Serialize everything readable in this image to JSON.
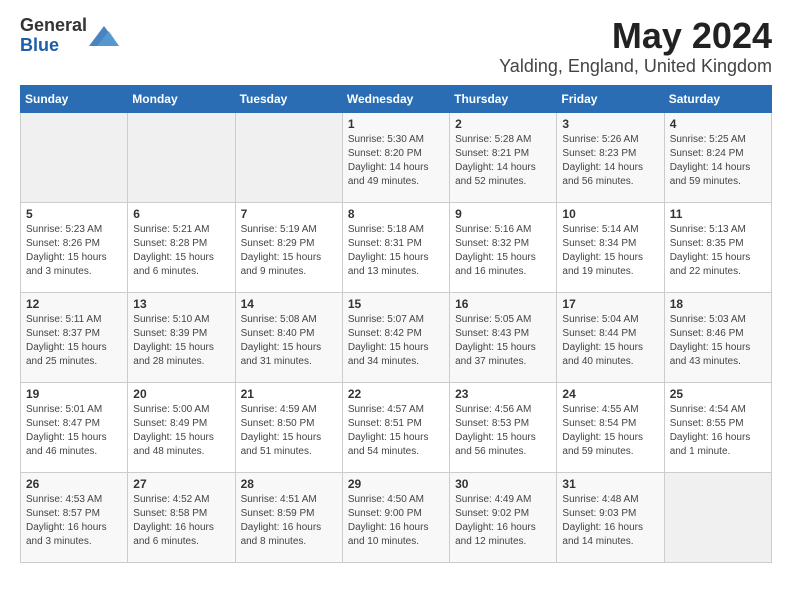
{
  "header": {
    "logo_general": "General",
    "logo_blue": "Blue",
    "month": "May 2024",
    "location": "Yalding, England, United Kingdom"
  },
  "weekdays": [
    "Sunday",
    "Monday",
    "Tuesday",
    "Wednesday",
    "Thursday",
    "Friday",
    "Saturday"
  ],
  "weeks": [
    [
      {
        "day": "",
        "sunrise": "",
        "sunset": "",
        "daylight": ""
      },
      {
        "day": "",
        "sunrise": "",
        "sunset": "",
        "daylight": ""
      },
      {
        "day": "",
        "sunrise": "",
        "sunset": "",
        "daylight": ""
      },
      {
        "day": "1",
        "sunrise": "Sunrise: 5:30 AM",
        "sunset": "Sunset: 8:20 PM",
        "daylight": "Daylight: 14 hours and 49 minutes."
      },
      {
        "day": "2",
        "sunrise": "Sunrise: 5:28 AM",
        "sunset": "Sunset: 8:21 PM",
        "daylight": "Daylight: 14 hours and 52 minutes."
      },
      {
        "day": "3",
        "sunrise": "Sunrise: 5:26 AM",
        "sunset": "Sunset: 8:23 PM",
        "daylight": "Daylight: 14 hours and 56 minutes."
      },
      {
        "day": "4",
        "sunrise": "Sunrise: 5:25 AM",
        "sunset": "Sunset: 8:24 PM",
        "daylight": "Daylight: 14 hours and 59 minutes."
      }
    ],
    [
      {
        "day": "5",
        "sunrise": "Sunrise: 5:23 AM",
        "sunset": "Sunset: 8:26 PM",
        "daylight": "Daylight: 15 hours and 3 minutes."
      },
      {
        "day": "6",
        "sunrise": "Sunrise: 5:21 AM",
        "sunset": "Sunset: 8:28 PM",
        "daylight": "Daylight: 15 hours and 6 minutes."
      },
      {
        "day": "7",
        "sunrise": "Sunrise: 5:19 AM",
        "sunset": "Sunset: 8:29 PM",
        "daylight": "Daylight: 15 hours and 9 minutes."
      },
      {
        "day": "8",
        "sunrise": "Sunrise: 5:18 AM",
        "sunset": "Sunset: 8:31 PM",
        "daylight": "Daylight: 15 hours and 13 minutes."
      },
      {
        "day": "9",
        "sunrise": "Sunrise: 5:16 AM",
        "sunset": "Sunset: 8:32 PM",
        "daylight": "Daylight: 15 hours and 16 minutes."
      },
      {
        "day": "10",
        "sunrise": "Sunrise: 5:14 AM",
        "sunset": "Sunset: 8:34 PM",
        "daylight": "Daylight: 15 hours and 19 minutes."
      },
      {
        "day": "11",
        "sunrise": "Sunrise: 5:13 AM",
        "sunset": "Sunset: 8:35 PM",
        "daylight": "Daylight: 15 hours and 22 minutes."
      }
    ],
    [
      {
        "day": "12",
        "sunrise": "Sunrise: 5:11 AM",
        "sunset": "Sunset: 8:37 PM",
        "daylight": "Daylight: 15 hours and 25 minutes."
      },
      {
        "day": "13",
        "sunrise": "Sunrise: 5:10 AM",
        "sunset": "Sunset: 8:39 PM",
        "daylight": "Daylight: 15 hours and 28 minutes."
      },
      {
        "day": "14",
        "sunrise": "Sunrise: 5:08 AM",
        "sunset": "Sunset: 8:40 PM",
        "daylight": "Daylight: 15 hours and 31 minutes."
      },
      {
        "day": "15",
        "sunrise": "Sunrise: 5:07 AM",
        "sunset": "Sunset: 8:42 PM",
        "daylight": "Daylight: 15 hours and 34 minutes."
      },
      {
        "day": "16",
        "sunrise": "Sunrise: 5:05 AM",
        "sunset": "Sunset: 8:43 PM",
        "daylight": "Daylight: 15 hours and 37 minutes."
      },
      {
        "day": "17",
        "sunrise": "Sunrise: 5:04 AM",
        "sunset": "Sunset: 8:44 PM",
        "daylight": "Daylight: 15 hours and 40 minutes."
      },
      {
        "day": "18",
        "sunrise": "Sunrise: 5:03 AM",
        "sunset": "Sunset: 8:46 PM",
        "daylight": "Daylight: 15 hours and 43 minutes."
      }
    ],
    [
      {
        "day": "19",
        "sunrise": "Sunrise: 5:01 AM",
        "sunset": "Sunset: 8:47 PM",
        "daylight": "Daylight: 15 hours and 46 minutes."
      },
      {
        "day": "20",
        "sunrise": "Sunrise: 5:00 AM",
        "sunset": "Sunset: 8:49 PM",
        "daylight": "Daylight: 15 hours and 48 minutes."
      },
      {
        "day": "21",
        "sunrise": "Sunrise: 4:59 AM",
        "sunset": "Sunset: 8:50 PM",
        "daylight": "Daylight: 15 hours and 51 minutes."
      },
      {
        "day": "22",
        "sunrise": "Sunrise: 4:57 AM",
        "sunset": "Sunset: 8:51 PM",
        "daylight": "Daylight: 15 hours and 54 minutes."
      },
      {
        "day": "23",
        "sunrise": "Sunrise: 4:56 AM",
        "sunset": "Sunset: 8:53 PM",
        "daylight": "Daylight: 15 hours and 56 minutes."
      },
      {
        "day": "24",
        "sunrise": "Sunrise: 4:55 AM",
        "sunset": "Sunset: 8:54 PM",
        "daylight": "Daylight: 15 hours and 59 minutes."
      },
      {
        "day": "25",
        "sunrise": "Sunrise: 4:54 AM",
        "sunset": "Sunset: 8:55 PM",
        "daylight": "Daylight: 16 hours and 1 minute."
      }
    ],
    [
      {
        "day": "26",
        "sunrise": "Sunrise: 4:53 AM",
        "sunset": "Sunset: 8:57 PM",
        "daylight": "Daylight: 16 hours and 3 minutes."
      },
      {
        "day": "27",
        "sunrise": "Sunrise: 4:52 AM",
        "sunset": "Sunset: 8:58 PM",
        "daylight": "Daylight: 16 hours and 6 minutes."
      },
      {
        "day": "28",
        "sunrise": "Sunrise: 4:51 AM",
        "sunset": "Sunset: 8:59 PM",
        "daylight": "Daylight: 16 hours and 8 minutes."
      },
      {
        "day": "29",
        "sunrise": "Sunrise: 4:50 AM",
        "sunset": "Sunset: 9:00 PM",
        "daylight": "Daylight: 16 hours and 10 minutes."
      },
      {
        "day": "30",
        "sunrise": "Sunrise: 4:49 AM",
        "sunset": "Sunset: 9:02 PM",
        "daylight": "Daylight: 16 hours and 12 minutes."
      },
      {
        "day": "31",
        "sunrise": "Sunrise: 4:48 AM",
        "sunset": "Sunset: 9:03 PM",
        "daylight": "Daylight: 16 hours and 14 minutes."
      },
      {
        "day": "",
        "sunrise": "",
        "sunset": "",
        "daylight": ""
      }
    ]
  ]
}
